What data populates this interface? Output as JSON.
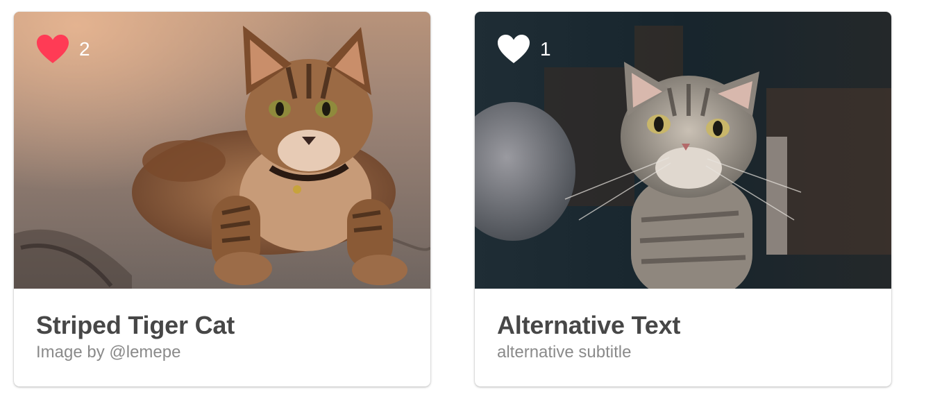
{
  "cards": [
    {
      "image_icon": "striped-tabby-kitten-photo",
      "likes": "2",
      "liked": true,
      "heart_color": "#FF3B55",
      "title": "Striped Tiger Cat",
      "subtitle": "Image by @lemepe"
    },
    {
      "image_icon": "grey-tabby-cat-photo",
      "likes": "1",
      "liked": false,
      "heart_color": "#FFFFFF",
      "title": "Alternative Text",
      "subtitle": "alternative subtitle"
    }
  ],
  "colors": {
    "title": "#474747",
    "subtitle": "#8A8A8A",
    "card_background": "#FFFFFF"
  }
}
